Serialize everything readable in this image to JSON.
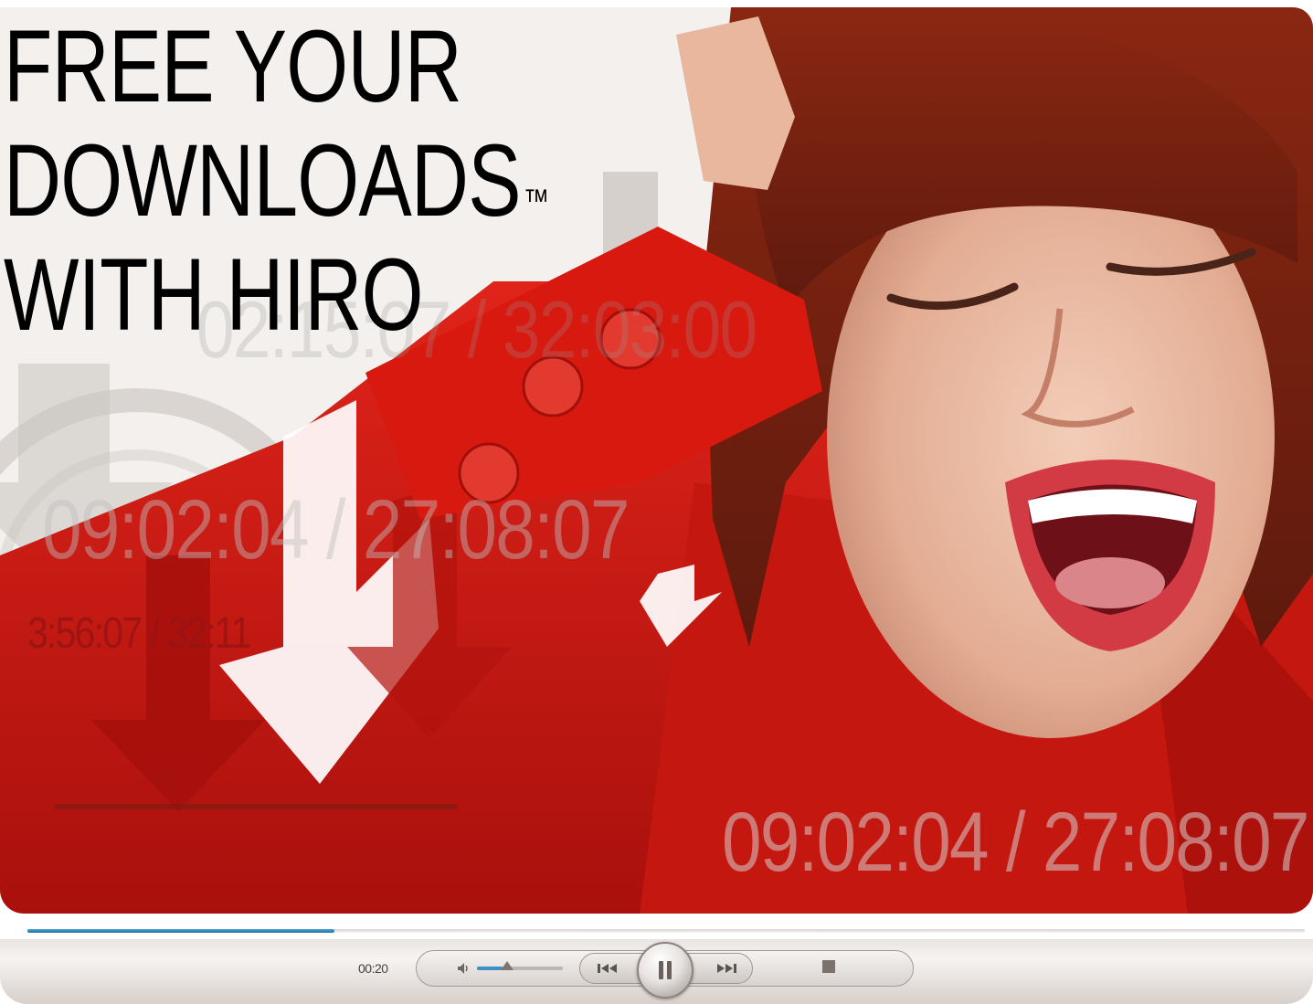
{
  "headline": {
    "line1": "FREE YOUR",
    "line2": "DOWNLOADS",
    "trademark": "™",
    "line3": "WITH HIRO"
  },
  "overlay_times": {
    "t1": "02:15:07 / 32:03:00",
    "t2": "09:02:04 / 27:08:07",
    "t3": "3:56:07 / 32:11",
    "t4": "09:02:04 / 27:08:07"
  },
  "player": {
    "elapsed": "00:20",
    "progress_fraction": 0.24,
    "volume_fraction": 0.3
  },
  "colors": {
    "accent_red": "#d4140f",
    "progress_blue": "#2f8bc0"
  }
}
